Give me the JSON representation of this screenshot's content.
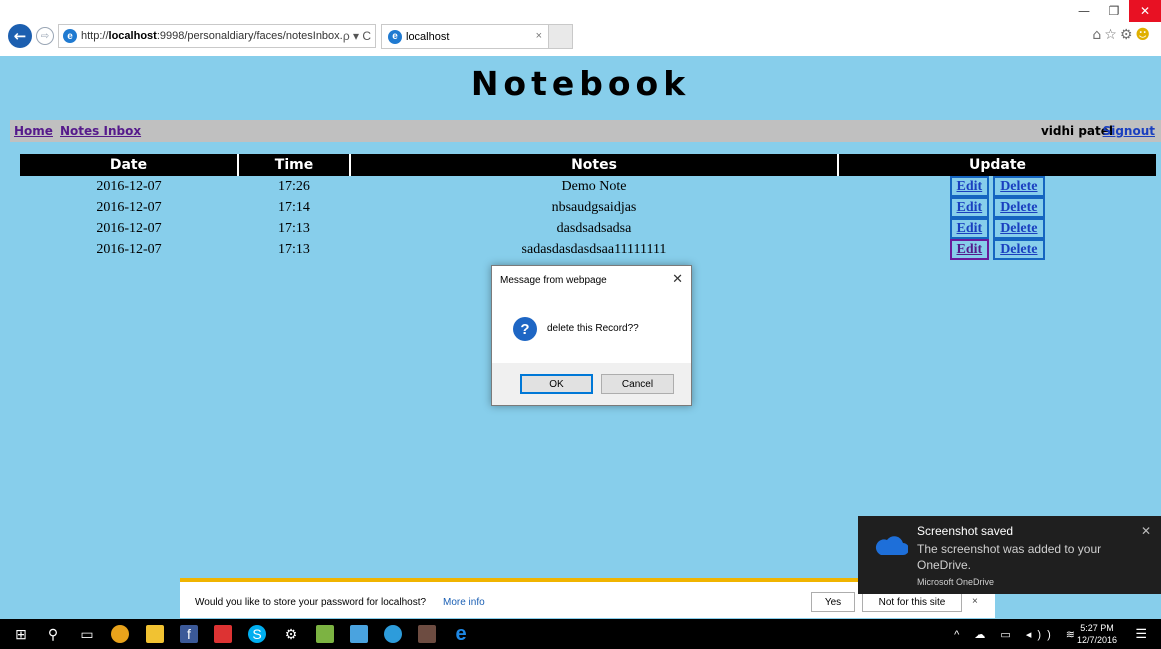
{
  "browser": {
    "address_prefix": "http://",
    "address_host": "localhost",
    "address_rest": ":9998/personaldiary/faces/notesInbox.",
    "address_tools": "ρ ▾ C",
    "tab_title": "localhost",
    "tab_close": "×"
  },
  "page": {
    "title": "Notebook",
    "nav": {
      "home": "Home",
      "inbox": "Notes Inbox",
      "user": "vidhi patel",
      "signout": "Signout"
    },
    "table": {
      "headers": [
        "Date",
        "Time",
        "Notes",
        "Update"
      ],
      "rows": [
        {
          "date": "2016-12-07",
          "time": "17:26",
          "note": "Demo Note",
          "edit": "Edit",
          "delete": "Delete"
        },
        {
          "date": "2016-12-07",
          "time": "17:14",
          "note": "nbsaudgsaidjas",
          "edit": "Edit",
          "delete": "Delete"
        },
        {
          "date": "2016-12-07",
          "time": "17:13",
          "note": "dasdsadsadsa",
          "edit": "Edit",
          "delete": "Delete"
        },
        {
          "date": "2016-12-07",
          "time": "17:13",
          "note": "sadasdasdasdsaa11111111",
          "edit": "Edit",
          "delete": "Delete"
        }
      ]
    }
  },
  "dialog": {
    "title": "Message from webpage",
    "close": "✕",
    "icon": "?",
    "message": "delete this Record??",
    "ok": "OK",
    "cancel": "Cancel"
  },
  "password_bar": {
    "message": "Would you like to store your password for localhost?",
    "more_info": "More info",
    "yes": "Yes",
    "no": "Not for this site",
    "close": "×"
  },
  "toast": {
    "title": "Screenshot saved",
    "body": "The screenshot was added to your OneDrive.",
    "app": "Microsoft OneDrive",
    "close": "✕"
  },
  "taskbar": {
    "time": "5:27 PM",
    "date": "12/7/2016"
  },
  "colors": {
    "page_bg": "#87ceeb",
    "nav_bg": "#c0c0c0",
    "header_bg": "#000000",
    "link": "#551a8b",
    "signout": "#1a3fbf",
    "button_border": "#1565c0"
  }
}
